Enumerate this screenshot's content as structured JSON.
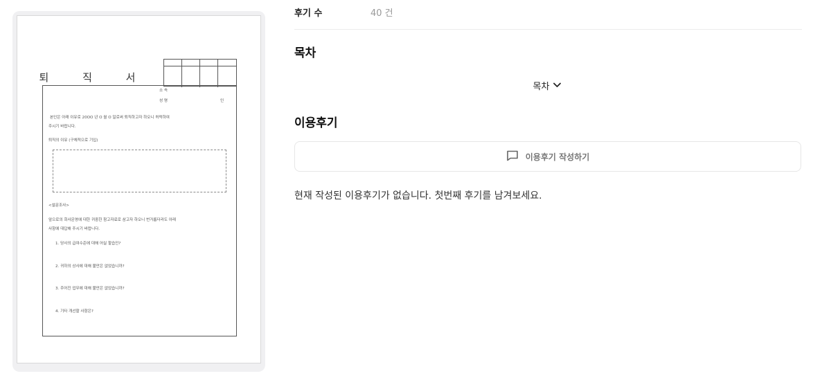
{
  "document_preview": {
    "title": "퇴 직 서",
    "affiliation_label": "소 속",
    "name_label": "성 명",
    "seal_label": "인",
    "statement_line1": "본인은 아래 이유로 20OO 년 O 월 O 일로써 퇴직하고자 하오니 허락하여",
    "statement_line2": "주시기 바랍니다.",
    "reason_label": "퇴직의 이유 (구체적으로 기입)",
    "survey_header": "<설문조사>",
    "survey_intro_line1": "앞으로의 회사운영에 대한 귀중한 참고자료로 삼고자 하오니 번거롭더라도 아래",
    "survey_intro_line2": "사항에 대답해 주시기 바랍니다.",
    "questions": [
      "1. 당사의 급여수준에 대해 어실 할습인?",
      "2. 귀하의 상사에 대해 불만은 없었습니까?",
      "3. 주어진 업무에 대해 불만은 없었습니까?",
      "4. 기타 개선할 사항은?"
    ]
  },
  "meta": {
    "review_count_label": "후기 수",
    "review_count_value": "40 건"
  },
  "toc": {
    "title": "목차",
    "toggle_label": "목차",
    "toggle_icon": "chevron-down-icon"
  },
  "reviews": {
    "title": "이용후기",
    "write_button_label": "이용후기 작성하기",
    "write_button_icon": "comment-icon",
    "empty_message": "현재 작성된 이용후기가 없습니다. 첫번째 후기를 남겨보세요."
  }
}
